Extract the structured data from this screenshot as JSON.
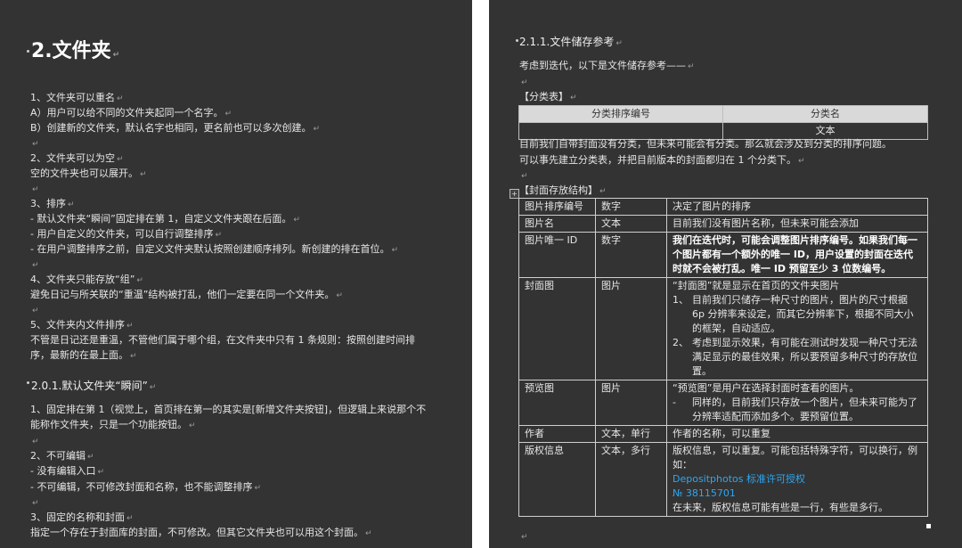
{
  "left": {
    "title": "2.文件夹",
    "lines": [
      "1、文件夹可以重名",
      "A）用户可以给不同的文件夹起同一个名字。",
      "B）创建新的文件夹，默认名字也相同，更名前也可以多次创建。",
      "",
      "2、文件夹可以为空",
      "空的文件夹也可以展开。",
      "",
      "3、排序",
      "-    默认文件夹“瞬间”固定排在第 1，自定义文件夹跟在后面。",
      "-    用户自定义的文件夹，可以自行调整排序",
      "-    在用户调整排序之前，自定义文件夹默认按照创建顺序排列。新创建的排在首位。",
      "",
      "4、文件夹只能存放“组”",
      "避免日记与所关联的“重温”结构被打乱，他们一定要在同一个文件夹。",
      "",
      "5、文件夹内文件排序",
      "不管是日记还是重温，不管他们属于哪个组，在文件夹中只有  1  条规则：按照创建时间排",
      "序，最新的在最上面。"
    ],
    "subtitle": "2.0.1.默认文件夹“瞬间”",
    "lines2": [
      "1、固定排在第 1（视觉上，首页排在第一的其实是[新增文件夹按钮]，但逻辑上来说那个不",
      "能称作文件夹，只是一个功能按钮。",
      "",
      "2、不可编辑",
      "-  没有编辑入口",
      "-  不可编辑，不可修改封面和名称，也不能调整排序",
      "",
      "3、固定的名称和封面",
      "指定一个存在于封面库的封面，不可修改。但其它文件夹也可以用这个封面。"
    ]
  },
  "right": {
    "title": "2.1.1.文件储存参考",
    "intro": "考虑到迭代，以下是文件储存参考——",
    "category_label": "【分类表】",
    "category_table": {
      "headers": [
        "分类排序编号",
        "分类名"
      ],
      "row": [
        "",
        "文本"
      ]
    },
    "category_note": [
      "目前我们自带封面没有分类，但未来可能会有分类。那么就会涉及到分类的排序问题。",
      "可以事先建立分类表，并把目前版本的封面都归在 1 个分类下。"
    ],
    "cover_label": "【封面存放结构】",
    "cover_rows": [
      {
        "field": "图片排序编号",
        "type": "数字",
        "desc": "决定了图片的排序"
      },
      {
        "field": "图片名",
        "type": "文本",
        "desc": "目前我们没有图片名称，但未来可能会添加"
      },
      {
        "field": "图片唯一 ID",
        "type": "数字",
        "desc_bold": "我们在迭代时，可能会调整图片排序编号。如果我们每一个图片都有一个额外的唯一 ID，用户设置的封面在迭代时就不会被打乱。唯一 ID 预留至少 3 位数编号。"
      },
      {
        "field": "封面图",
        "type": "图片",
        "desc": "“封面图”就是显示在首页的文件夹图片",
        "items": [
          {
            "n": "1、",
            "t": "目前我们只储存一种尺寸的图片，图片的尺寸根据 6p 分辨率来设定，而其它分辨率下，根据不同大小的框架，自动适应。"
          },
          {
            "n": "2、",
            "t": "考虑到显示效果，有可能在测试时发现一种尺寸无法满足显示的最佳效果，所以要预留多种尺寸的存放位置。"
          }
        ]
      },
      {
        "field": "预览图",
        "type": "图片",
        "desc": "“预览图”是用户在选择封面时查看的图片。",
        "items": [
          {
            "n": "-",
            "t": "同样的，目前我们只存放一个图片，但未来可能为了分辨率适配而添加多个。要预留位置。"
          }
        ]
      },
      {
        "field": "作者",
        "type": "文本，单行",
        "desc": "作者的名称，可以重复"
      },
      {
        "field": "版权信息",
        "type": "文本，多行",
        "desc": "版权信息，可以重复。可能包括特殊字符，可以换行，例如：",
        "link1": "Depositphotos 标准许可授权",
        "link2": "№ 38115701",
        "tail": "在未来，版权信息可能有些是一行，有些是多行。"
      }
    ]
  },
  "icons": {
    "paragraph_mark": "↵",
    "table_move": "+"
  }
}
